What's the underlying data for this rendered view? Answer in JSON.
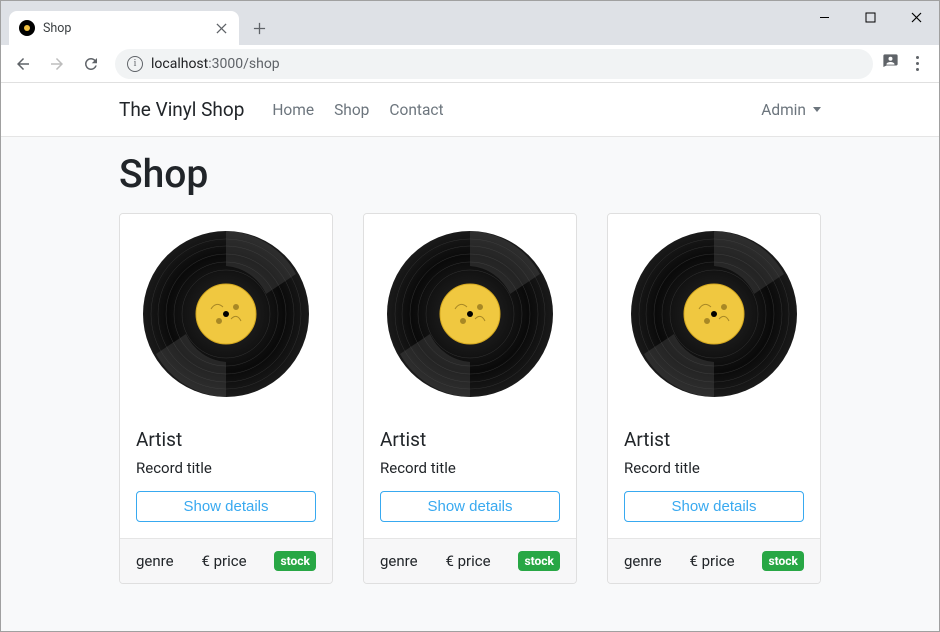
{
  "window": {
    "tab_title": "Shop"
  },
  "browser": {
    "url_host": "localhost",
    "url_port_path": ":3000/shop"
  },
  "navbar": {
    "brand": "The Vinyl Shop",
    "links": [
      "Home",
      "Shop",
      "Contact"
    ],
    "admin_label": "Admin"
  },
  "page": {
    "title": "Shop"
  },
  "cards": [
    {
      "artist": "Artist",
      "title": "Record title",
      "button": "Show details",
      "genre": "genre",
      "price": "€ price",
      "stock": "stock"
    },
    {
      "artist": "Artist",
      "title": "Record title",
      "button": "Show details",
      "genre": "genre",
      "price": "€ price",
      "stock": "stock"
    },
    {
      "artist": "Artist",
      "title": "Record title",
      "button": "Show details",
      "genre": "genre",
      "price": "€ price",
      "stock": "stock"
    }
  ]
}
